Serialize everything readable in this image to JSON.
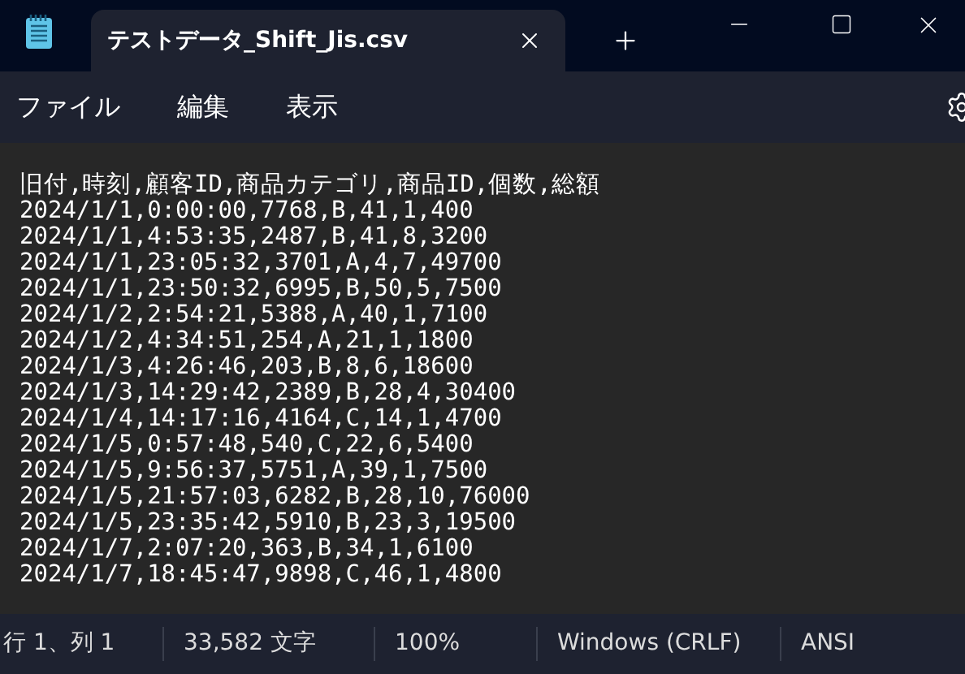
{
  "tab": {
    "title": "テストデータ_Shift_Jis.csv",
    "selected": true
  },
  "menu": [
    "ファイル",
    "編集",
    "表示"
  ],
  "editor": {
    "lines": [
      "旧付,時刻,顧客ID,商品カテゴリ,商品ID,個数,総額",
      "2024/1/1,0:00:00,7768,B,41,1,400",
      "2024/1/1,4:53:35,2487,B,41,8,3200",
      "2024/1/1,23:05:32,3701,A,4,7,49700",
      "2024/1/1,23:50:32,6995,B,50,5,7500",
      "2024/1/2,2:54:21,5388,A,40,1,7100",
      "2024/1/2,4:34:51,254,A,21,1,1800",
      "2024/1/3,4:26:46,203,B,8,6,18600",
      "2024/1/3,14:29:42,2389,B,28,4,30400",
      "2024/1/4,14:17:16,4164,C,14,1,4700",
      "2024/1/5,0:57:48,540,C,22,6,5400",
      "2024/1/5,9:56:37,5751,A,39,1,7500",
      "2024/1/5,21:57:03,6282,B,28,10,76000",
      "2024/1/5,23:35:42,5910,B,23,3,19500",
      "2024/1/7,2:07:20,363,B,34,1,6100",
      "2024/1/7,18:45:47,9898,C,46,1,4800"
    ]
  },
  "status_bar": [
    "行 1、列 1",
    "33,582 文字",
    "100%",
    "Windows (CRLF)",
    "ANSI"
  ]
}
